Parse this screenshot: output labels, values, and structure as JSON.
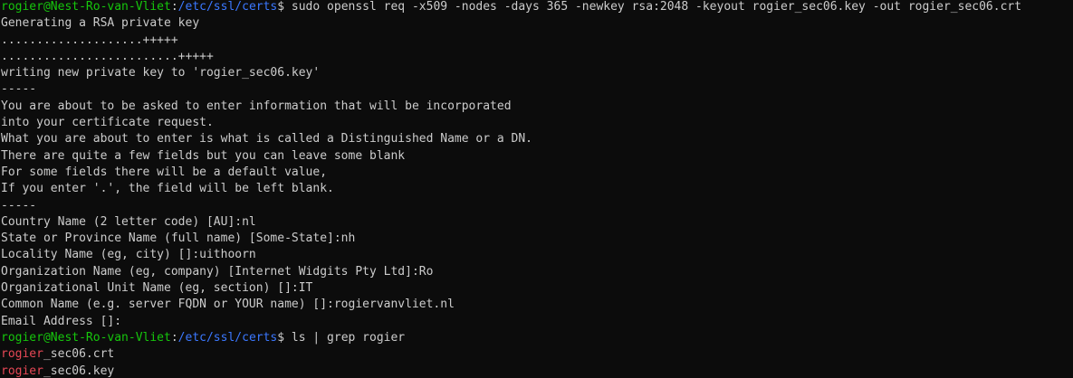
{
  "prompt": {
    "user_host": "rogier@Nest-Ro-van-Vliet",
    "separator": ":",
    "cwd": "/etc/ssl/certs",
    "symbol": "$ "
  },
  "commands": {
    "openssl": "sudo openssl req -x509 -nodes -days 365 -newkey rsa:2048 -keyout rogier_sec06.key -out rogier_sec06.crt",
    "ls": "ls | grep rogier"
  },
  "output": {
    "openssl": [
      "Generating a RSA private key",
      "....................+++++",
      ".........................+++++",
      "writing new private key to 'rogier_sec06.key'",
      "-----",
      "You are about to be asked to enter information that will be incorporated",
      "into your certificate request.",
      "What you are about to enter is what is called a Distinguished Name or a DN.",
      "There are quite a few fields but you can leave some blank",
      "For some fields there will be a default value,",
      "If you enter '.', the field will be left blank.",
      "-----",
      "Country Name (2 letter code) [AU]:nl",
      "State or Province Name (full name) [Some-State]:nh",
      "Locality Name (eg, city) []:uithoorn",
      "Organization Name (eg, company) [Internet Widgits Pty Ltd]:Ro",
      "Organizational Unit Name (eg, section) []:IT",
      "Common Name (e.g. server FQDN or YOUR name) []:rogiervanvliet.nl",
      "Email Address []:"
    ],
    "ls": [
      {
        "match": "rogier",
        "rest": "_sec06.crt"
      },
      {
        "match": "rogier",
        "rest": "_sec06.key"
      }
    ]
  },
  "colors": {
    "background": "#0c0c0c",
    "foreground": "#cccccc",
    "user_host": "#16c60c",
    "path": "#3b78ff",
    "grep_match": "#e74856"
  }
}
